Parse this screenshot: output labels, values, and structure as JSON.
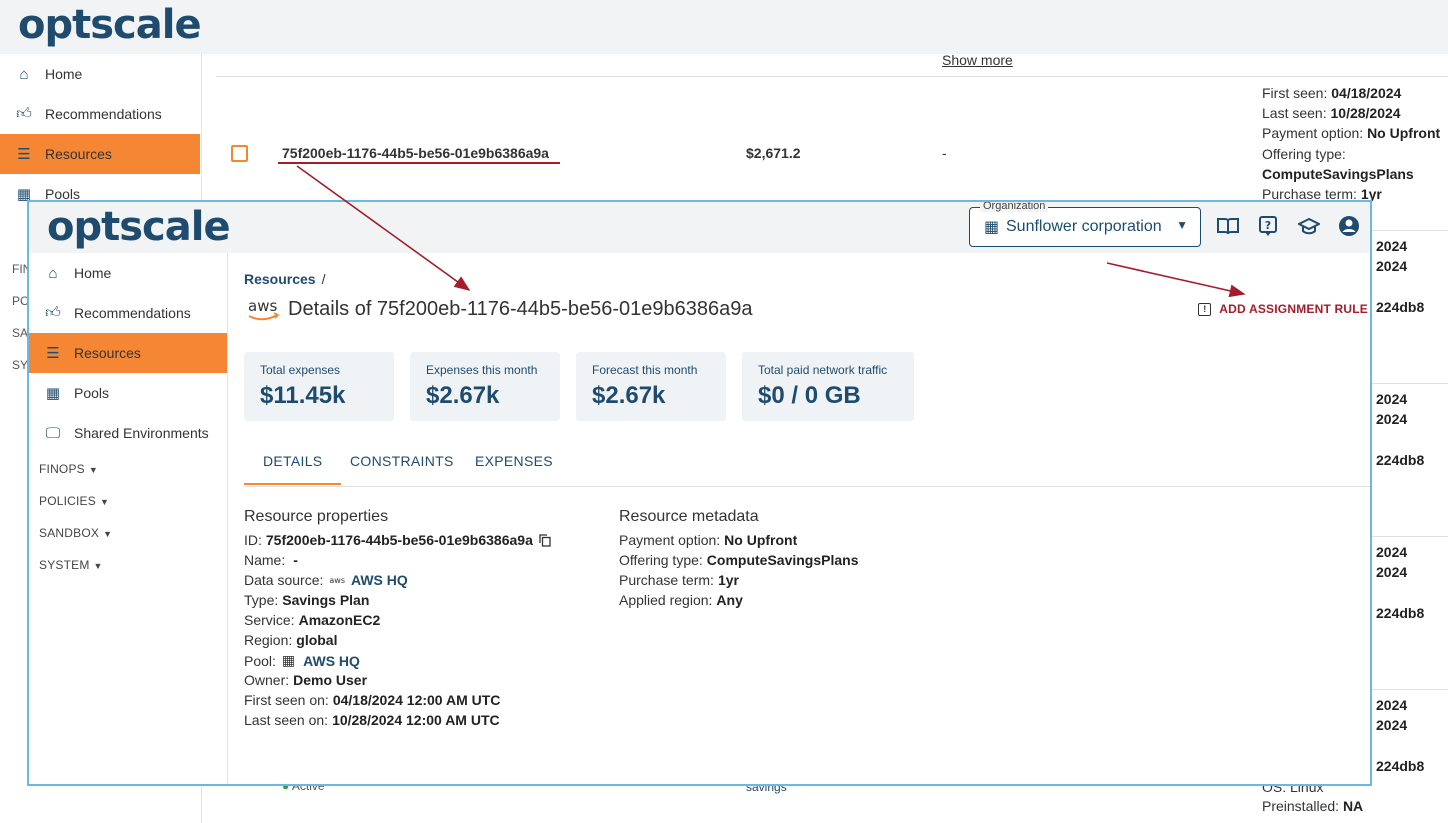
{
  "background": {
    "logo": "optscale",
    "sidebar": {
      "items": [
        {
          "label": "Home",
          "icon": "home-icon"
        },
        {
          "label": "Recommendations",
          "icon": "thumbs-up-icon"
        },
        {
          "label": "Resources",
          "icon": "resources-icon",
          "active": true
        },
        {
          "label": "Pools",
          "icon": "pools-icon"
        }
      ],
      "cut_labels": [
        "FIN",
        "PO",
        "SA",
        "SY"
      ]
    },
    "show_more": "Show more",
    "row": {
      "resource_id": "75f200eb-1176-44b5-be56-01e9b6386a9a",
      "cost": "$2,671.2",
      "dash": "-",
      "details": [
        {
          "label": "First seen:",
          "value": "04/18/2024"
        },
        {
          "label": "Last seen:",
          "value": "10/28/2024"
        },
        {
          "label": "Payment option:",
          "value": "No Upfront"
        },
        {
          "label": "Offering type:",
          "value": ""
        },
        {
          "label": "",
          "value": "ComputeSavingsPlans"
        },
        {
          "label": "Purchase term:",
          "value": "1yr"
        }
      ]
    },
    "right_fragments": {
      "year": "2024",
      "hash": "224db8"
    },
    "bottom_fragments": {
      "status": "Active",
      "savings": "savings",
      "os": "OS: Linux",
      "preinstalled_label": "Preinstalled:",
      "preinstalled_value": "NA"
    }
  },
  "overlay": {
    "logo": "optscale",
    "organization": {
      "label": "Organization",
      "value": "Sunflower corporation"
    },
    "header_icons": [
      "documentation-icon",
      "help-icon",
      "academy-icon",
      "profile-icon"
    ],
    "sidebar": {
      "items": [
        {
          "label": "Home"
        },
        {
          "label": "Recommendations"
        },
        {
          "label": "Resources"
        },
        {
          "label": "Pools"
        },
        {
          "label": "Shared Environments"
        }
      ],
      "sections": [
        "FINOPS",
        "POLICIES",
        "SANDBOX",
        "SYSTEM"
      ]
    },
    "breadcrumb": {
      "root": "Resources",
      "sep": "/"
    },
    "title": "Details of 75f200eb-1176-44b5-be56-01e9b6386a9a",
    "aws_logo_text": "aws",
    "assign_button": "ADD ASSIGNMENT RULE",
    "cards": [
      {
        "label": "Total expenses",
        "value": "$11.45k"
      },
      {
        "label": "Expenses this month",
        "value": "$2.67k"
      },
      {
        "label": "Forecast this month",
        "value": "$2.67k"
      },
      {
        "label": "Total paid network traffic",
        "value": "$0 / 0 GB"
      }
    ],
    "tabs": [
      "DETAILS",
      "CONSTRAINTS",
      "EXPENSES"
    ],
    "properties": {
      "title": "Resource properties",
      "id_label": "ID:",
      "id_value": "75f200eb-1176-44b5-be56-01e9b6386a9a",
      "name_label": "Name:",
      "name_value": "-",
      "datasource_label": "Data source:",
      "datasource_value": "AWS HQ",
      "type_label": "Type:",
      "type_value": "Savings Plan",
      "service_label": "Service:",
      "service_value": "AmazonEC2",
      "region_label": "Region:",
      "region_value": "global",
      "pool_label": "Pool:",
      "pool_value": "AWS HQ",
      "owner_label": "Owner:",
      "owner_value": "Demo User",
      "first_seen_label": "First seen on:",
      "first_seen_value": "04/18/2024 12:00 AM UTC",
      "last_seen_label": "Last seen on:",
      "last_seen_value": "10/28/2024 12:00 AM UTC"
    },
    "metadata": {
      "title": "Resource metadata",
      "payment_label": "Payment option:",
      "payment_value": "No Upfront",
      "offering_label": "Offering type:",
      "offering_value": "ComputeSavingsPlans",
      "term_label": "Purchase term:",
      "term_value": "1yr",
      "applied_label": "Applied region:",
      "applied_value": "Any"
    }
  },
  "colors": {
    "brand": "#1e4b6e",
    "accent": "#f58634",
    "annotation": "#a31d2b",
    "overlay_border": "#6ab9e0"
  }
}
